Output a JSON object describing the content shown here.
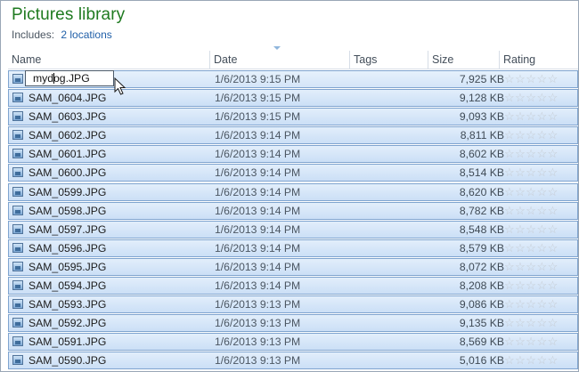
{
  "library": {
    "title": "Pictures library",
    "includes_label": "Includes:",
    "locations_link": "2 locations"
  },
  "columns": {
    "name": "Name",
    "date": "Date",
    "tags": "Tags",
    "size": "Size",
    "rating": "Rating"
  },
  "rename": {
    "value": "mydog.JPG"
  },
  "rows": [
    {
      "name": "mydog.JPG",
      "date": "1/6/2013 9:15 PM",
      "size": "7,925 KB",
      "stars": "☆☆☆☆☆"
    },
    {
      "name": "SAM_0604.JPG",
      "date": "1/6/2013 9:15 PM",
      "size": "9,128 KB",
      "stars": "☆☆☆☆☆"
    },
    {
      "name": "SAM_0603.JPG",
      "date": "1/6/2013 9:15 PM",
      "size": "9,093 KB",
      "stars": "☆☆☆☆☆"
    },
    {
      "name": "SAM_0602.JPG",
      "date": "1/6/2013 9:14 PM",
      "size": "8,811 KB",
      "stars": "☆☆☆☆☆"
    },
    {
      "name": "SAM_0601.JPG",
      "date": "1/6/2013 9:14 PM",
      "size": "8,602 KB",
      "stars": "☆☆☆☆☆"
    },
    {
      "name": "SAM_0600.JPG",
      "date": "1/6/2013 9:14 PM",
      "size": "8,514 KB",
      "stars": "☆☆☆☆☆"
    },
    {
      "name": "SAM_0599.JPG",
      "date": "1/6/2013 9:14 PM",
      "size": "8,620 KB",
      "stars": "☆☆☆☆☆"
    },
    {
      "name": "SAM_0598.JPG",
      "date": "1/6/2013 9:14 PM",
      "size": "8,782 KB",
      "stars": "☆☆☆☆☆"
    },
    {
      "name": "SAM_0597.JPG",
      "date": "1/6/2013 9:14 PM",
      "size": "8,548 KB",
      "stars": "☆☆☆☆☆"
    },
    {
      "name": "SAM_0596.JPG",
      "date": "1/6/2013 9:14 PM",
      "size": "8,579 KB",
      "stars": "☆☆☆☆☆"
    },
    {
      "name": "SAM_0595.JPG",
      "date": "1/6/2013 9:14 PM",
      "size": "8,072 KB",
      "stars": "☆☆☆☆☆"
    },
    {
      "name": "SAM_0594.JPG",
      "date": "1/6/2013 9:14 PM",
      "size": "8,208 KB",
      "stars": "☆☆☆☆☆"
    },
    {
      "name": "SAM_0593.JPG",
      "date": "1/6/2013 9:13 PM",
      "size": "9,086 KB",
      "stars": "☆☆☆☆☆"
    },
    {
      "name": "SAM_0592.JPG",
      "date": "1/6/2013 9:13 PM",
      "size": "9,135 KB",
      "stars": "☆☆☆☆☆"
    },
    {
      "name": "SAM_0591.JPG",
      "date": "1/6/2013 9:13 PM",
      "size": "8,569 KB",
      "stars": "☆☆☆☆☆"
    },
    {
      "name": "SAM_0590.JPG",
      "date": "1/6/2013 9:13 PM",
      "size": "5,016 KB",
      "stars": "☆☆☆☆☆"
    }
  ],
  "rating_value": 0,
  "icons": {
    "file": "image-file-icon",
    "cursor": "mouse-pointer-icon",
    "sort": "sort-arrow-icon"
  },
  "colors": {
    "title_green": "#1f7a20",
    "link_blue": "#1f5fa8",
    "selection_border": "#7fa4cf",
    "selection_fill": "#cbdff6"
  }
}
